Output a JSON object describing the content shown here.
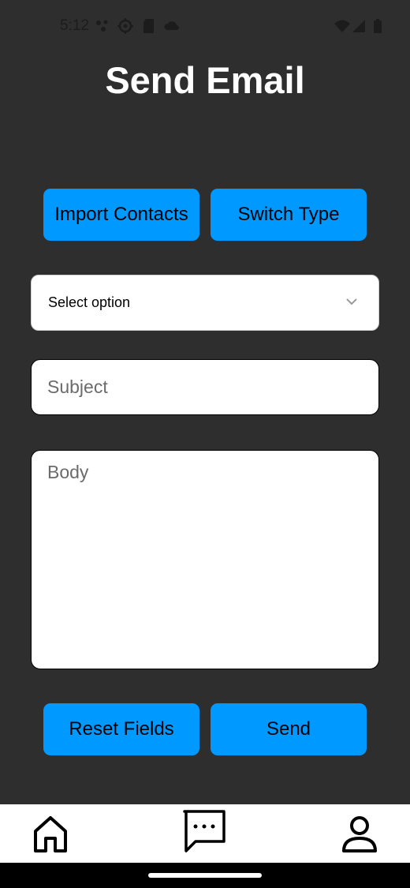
{
  "status_bar": {
    "time": "5:12",
    "icons": [
      "notification-dots-icon",
      "settings-gear-icon",
      "sd-card-icon",
      "cloud-icon",
      "wifi-icon",
      "cellular-signal-icon",
      "battery-icon"
    ]
  },
  "header": {
    "title": "Send Email"
  },
  "actions_top": {
    "import_contacts_label": "Import Contacts",
    "switch_type_label": "Switch Type"
  },
  "form": {
    "select": {
      "selected_value": "Select option"
    },
    "subject": {
      "placeholder": "Subject",
      "value": ""
    },
    "body": {
      "placeholder": "Body",
      "value": ""
    }
  },
  "actions_bottom": {
    "reset_label": "Reset Fields",
    "send_label": "Send"
  },
  "bottom_nav": {
    "items": [
      {
        "icon": "home-icon"
      },
      {
        "icon": "messages-icon"
      },
      {
        "icon": "profile-icon"
      }
    ]
  },
  "colors": {
    "background": "#2e2e2e",
    "accent": "#0099ff",
    "title_text": "#ffffff"
  }
}
